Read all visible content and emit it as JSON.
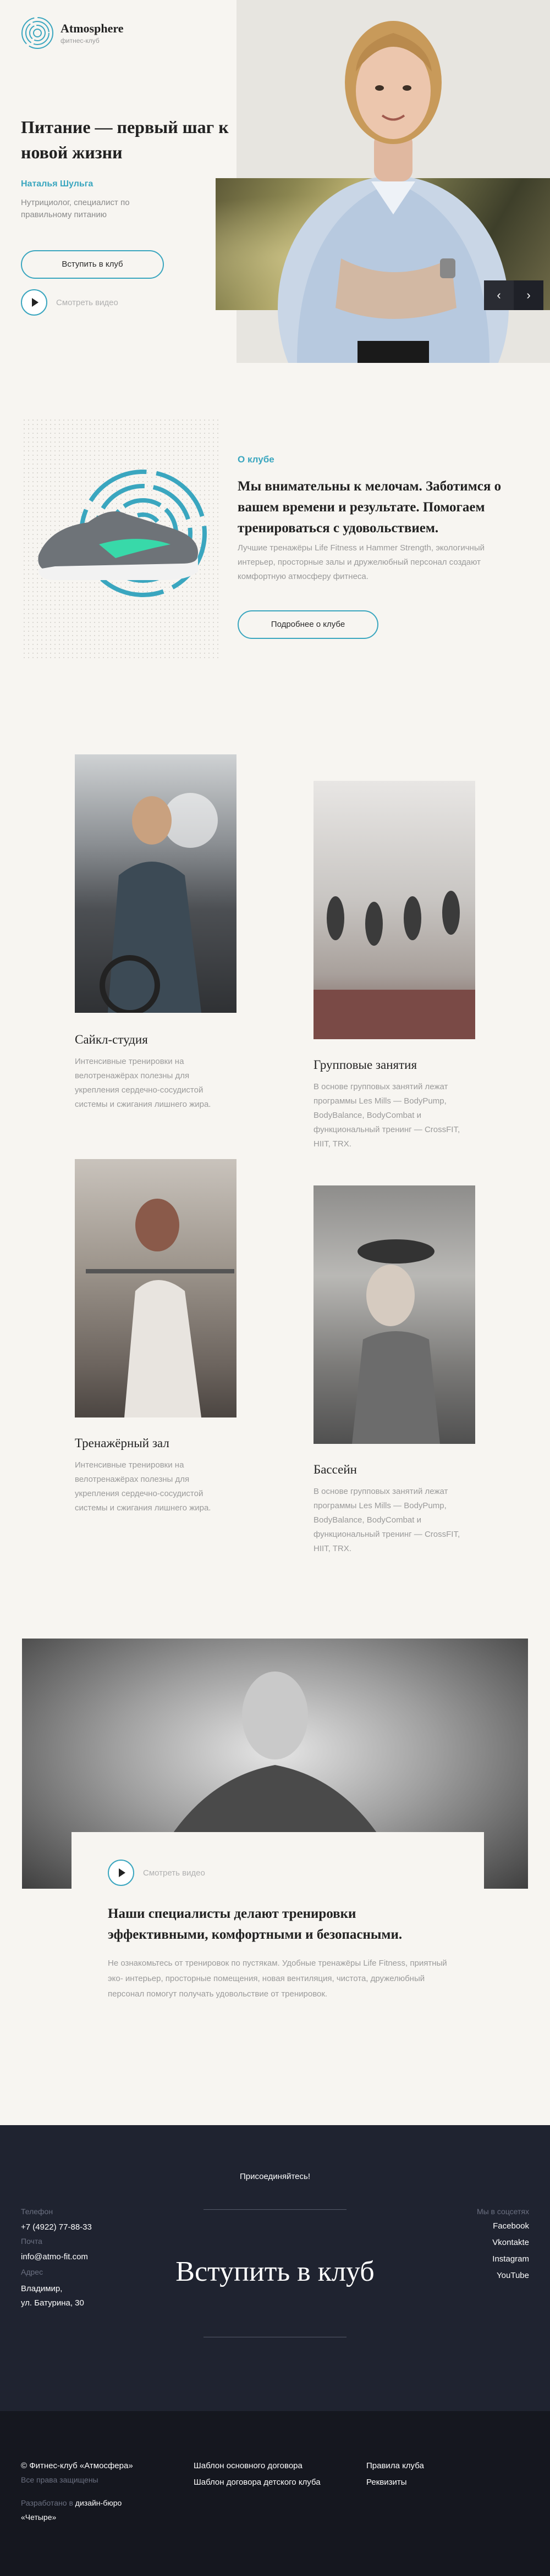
{
  "brand": {
    "name": "Atmosphere",
    "tagline": "фитнес-клуб"
  },
  "hero": {
    "title": "Питание — первый шаг к новой жизни",
    "name": "Наталья Шульга",
    "desc": "Нутрициолог, специалист по правильному питанию",
    "join_label": "Вступить в клуб",
    "video_label": "Смотреть видео",
    "prev_label": "‹",
    "next_label": "›"
  },
  "about": {
    "label": "О клубе",
    "title": "Мы внимательны к мелочам. Заботимся о вашем времени и результате. Помогаем тренироваться с удовольствием.",
    "desc": "Лучшие тренажёры Life Fitness и Hammer Strength, экологичный интерьер, просторные залы и дружелюбный персонал создают комфортную атмосферу фитнеса.",
    "button_label": "Подробнее о клубе"
  },
  "services": [
    {
      "title": "Сайкл-студия",
      "desc": "Интенсивные тренировки на велотренажёрах полезны для укрепления сердечно-сосудистой системы и сжигания лишнего жира."
    },
    {
      "title": "Групповые занятия",
      "desc": "В основе групповых занятий лежат программы Les Mills — BodyPump, BodyBalance, BodyCombat и функциональный тренинг — CrossFIT, HIIT, TRX."
    },
    {
      "title": "Тренажёрный зал",
      "desc": "Интенсивные тренировки на велотренажёрах полезны для укрепления сердечно-сосудистой системы и сжигания лишнего жира."
    },
    {
      "title": "Бассейн",
      "desc": "В основе групповых занятий лежат программы Les Mills — BodyPump, BodyBalance, BodyCombat и функциональный тренинг — CrossFIT, HIIT, TRX."
    }
  ],
  "banner": {
    "video_label": "Смотреть видео",
    "title": "Наши специалисты делают тренировки эффективными, комфортными и безопасными.",
    "desc": "Не ознакомьтесь от тренировок по пустякам. Удобные тренажёры Life Fitness, приятный эко- интерьер, просторные помещения, новая вентиляция, чистота, дружелюбный персонал помогут получать удовольствие от тренировок."
  },
  "join": {
    "small": "Присоединяйтесь!",
    "big": "Вступить в клуб",
    "phone_label": "Телефон",
    "phone": "+7 (4922) 77-88-33",
    "email_label": "Почта",
    "email": "info@atmo-fit.com",
    "address_label": "Адрес",
    "address_line1": "Владимир,",
    "address_line2": "ул. Батурина, 30",
    "social_label": "Мы в соцсетях",
    "social": [
      "Facebook",
      "Vkontakte",
      "Instagram",
      "YouTube"
    ]
  },
  "footer": {
    "copyright": "© Фитнес-клуб «Атмосфера»",
    "rights": "Все права защищены",
    "dev_prefix": "Разработано в",
    "dev_name": "дизайн-бюро",
    "dev_name2": "«Четыре»",
    "links_mid": [
      "Шаблон основного договора",
      "Шаблон договора детского клуба"
    ],
    "links_right": [
      "Правила клуба",
      "Реквизиты"
    ]
  },
  "colors": {
    "accent": "#3aa6bf",
    "dark": "#1f2330",
    "footer": "#15171f",
    "bg": "#f7f5f1"
  },
  "icons": [
    "logo-rings-icon",
    "play-icon",
    "chevron-left-icon",
    "chevron-right-icon"
  ]
}
